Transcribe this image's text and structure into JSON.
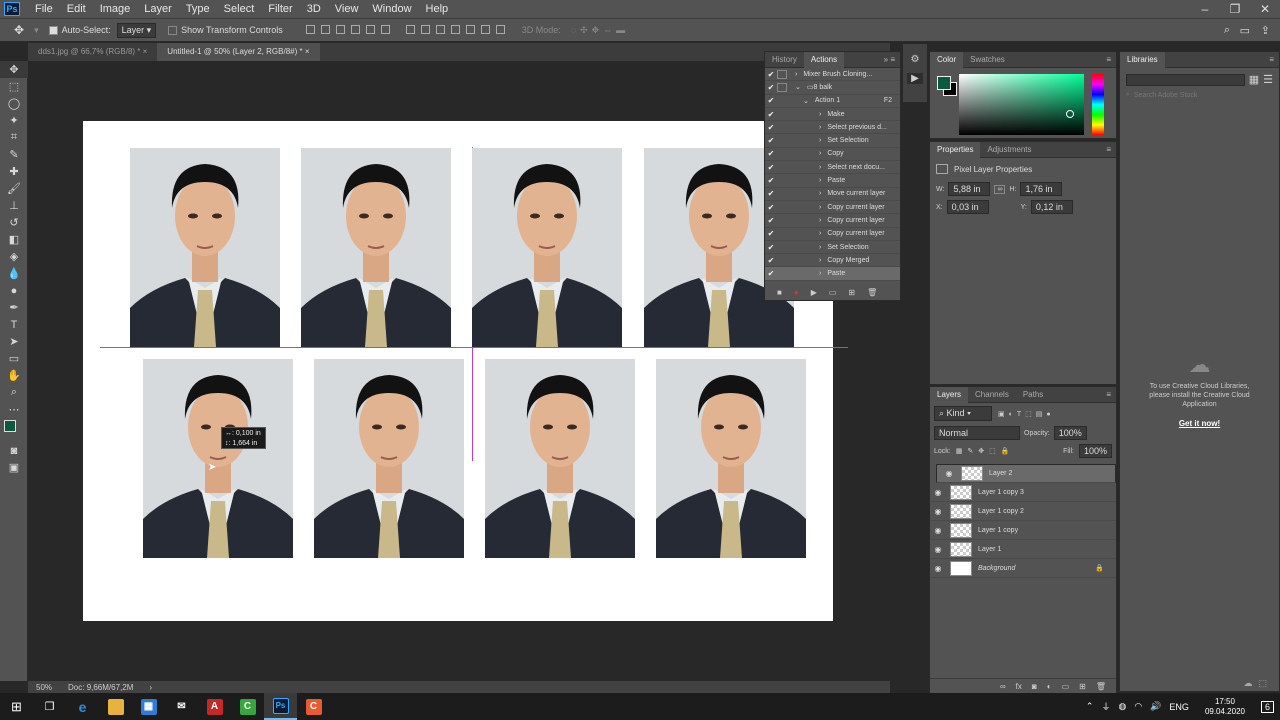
{
  "menubar": {
    "logo": "Ps",
    "items": [
      "File",
      "Edit",
      "Image",
      "Layer",
      "Type",
      "Select",
      "Filter",
      "3D",
      "View",
      "Window",
      "Help"
    ]
  },
  "options": {
    "auto_select_label": "Auto-Select:",
    "auto_select_value": "Layer",
    "transform_label": "Show Transform Controls",
    "mode3d": "3D Mode:"
  },
  "tabs": [
    {
      "label": "dds1.jpg @ 66,7% (RGB/8) *"
    },
    {
      "label": "Untitled-1 @ 50% (Layer 2, RGB/8#) *"
    }
  ],
  "tooltip": {
    "w": "↔: 0,100 in",
    "h": "↕: 1,664 in"
  },
  "status": {
    "zoom": "50%",
    "doc": "Doc: 9,66M/67,2M"
  },
  "actions_panel": {
    "tabs": [
      "History",
      "Actions"
    ],
    "rows": [
      {
        "label": "Mixer Brush Cloning...",
        "level": 1
      },
      {
        "label": "8 balk",
        "level": 1
      },
      {
        "label": "Action 1",
        "level": 2,
        "key": "F2"
      },
      {
        "label": "Make",
        "level": 3
      },
      {
        "label": "Select previous d...",
        "level": 3
      },
      {
        "label": "Set Selection",
        "level": 3
      },
      {
        "label": "Copy",
        "level": 3
      },
      {
        "label": "Select next docu...",
        "level": 3
      },
      {
        "label": "Paste",
        "level": 3
      },
      {
        "label": "Move current layer",
        "level": 3
      },
      {
        "label": "Copy current layer",
        "level": 3
      },
      {
        "label": "Copy current layer",
        "level": 3
      },
      {
        "label": "Copy current layer",
        "level": 3
      },
      {
        "label": "Set Selection",
        "level": 3
      },
      {
        "label": "Copy Merged",
        "level": 3
      },
      {
        "label": "Paste",
        "level": 3
      }
    ]
  },
  "color_panel": {
    "tabs": [
      "Color",
      "Swatches"
    ],
    "foreground": "#0b5a40",
    "background": "#000000",
    "hue_color": "#00ff99"
  },
  "properties_panel": {
    "tabs": [
      "Properties",
      "Adjustments"
    ],
    "title": "Pixel Layer Properties",
    "w_label": "W:",
    "w": "5,88 in",
    "h_label": "H:",
    "h": "1,76 in",
    "x_label": "X:",
    "x": "0,03 in",
    "y_label": "Y:",
    "y": "0,12 in"
  },
  "layers_panel": {
    "tabs": [
      "Layers",
      "Channels",
      "Paths"
    ],
    "kind": "Kind",
    "blend": "Normal",
    "opacity_label": "Opacity:",
    "opacity": "100%",
    "lock_label": "Lock:",
    "fill_label": "Fill:",
    "fill": "100%",
    "layers": [
      "Layer 2",
      "Layer 1 copy 3",
      "Layer 1 copy 2",
      "Layer 1 copy",
      "Layer 1",
      "Background"
    ]
  },
  "libraries_panel": {
    "tab": "Libraries",
    "search_placeholder": "Search Adobe Stock",
    "message": "To use Creative Cloud Libraries, please install the Creative Cloud Application",
    "link": "Get it now!"
  },
  "taskbar": {
    "lang": "ENG",
    "time": "17:50",
    "date": "09.04.2020",
    "notif": "6"
  }
}
